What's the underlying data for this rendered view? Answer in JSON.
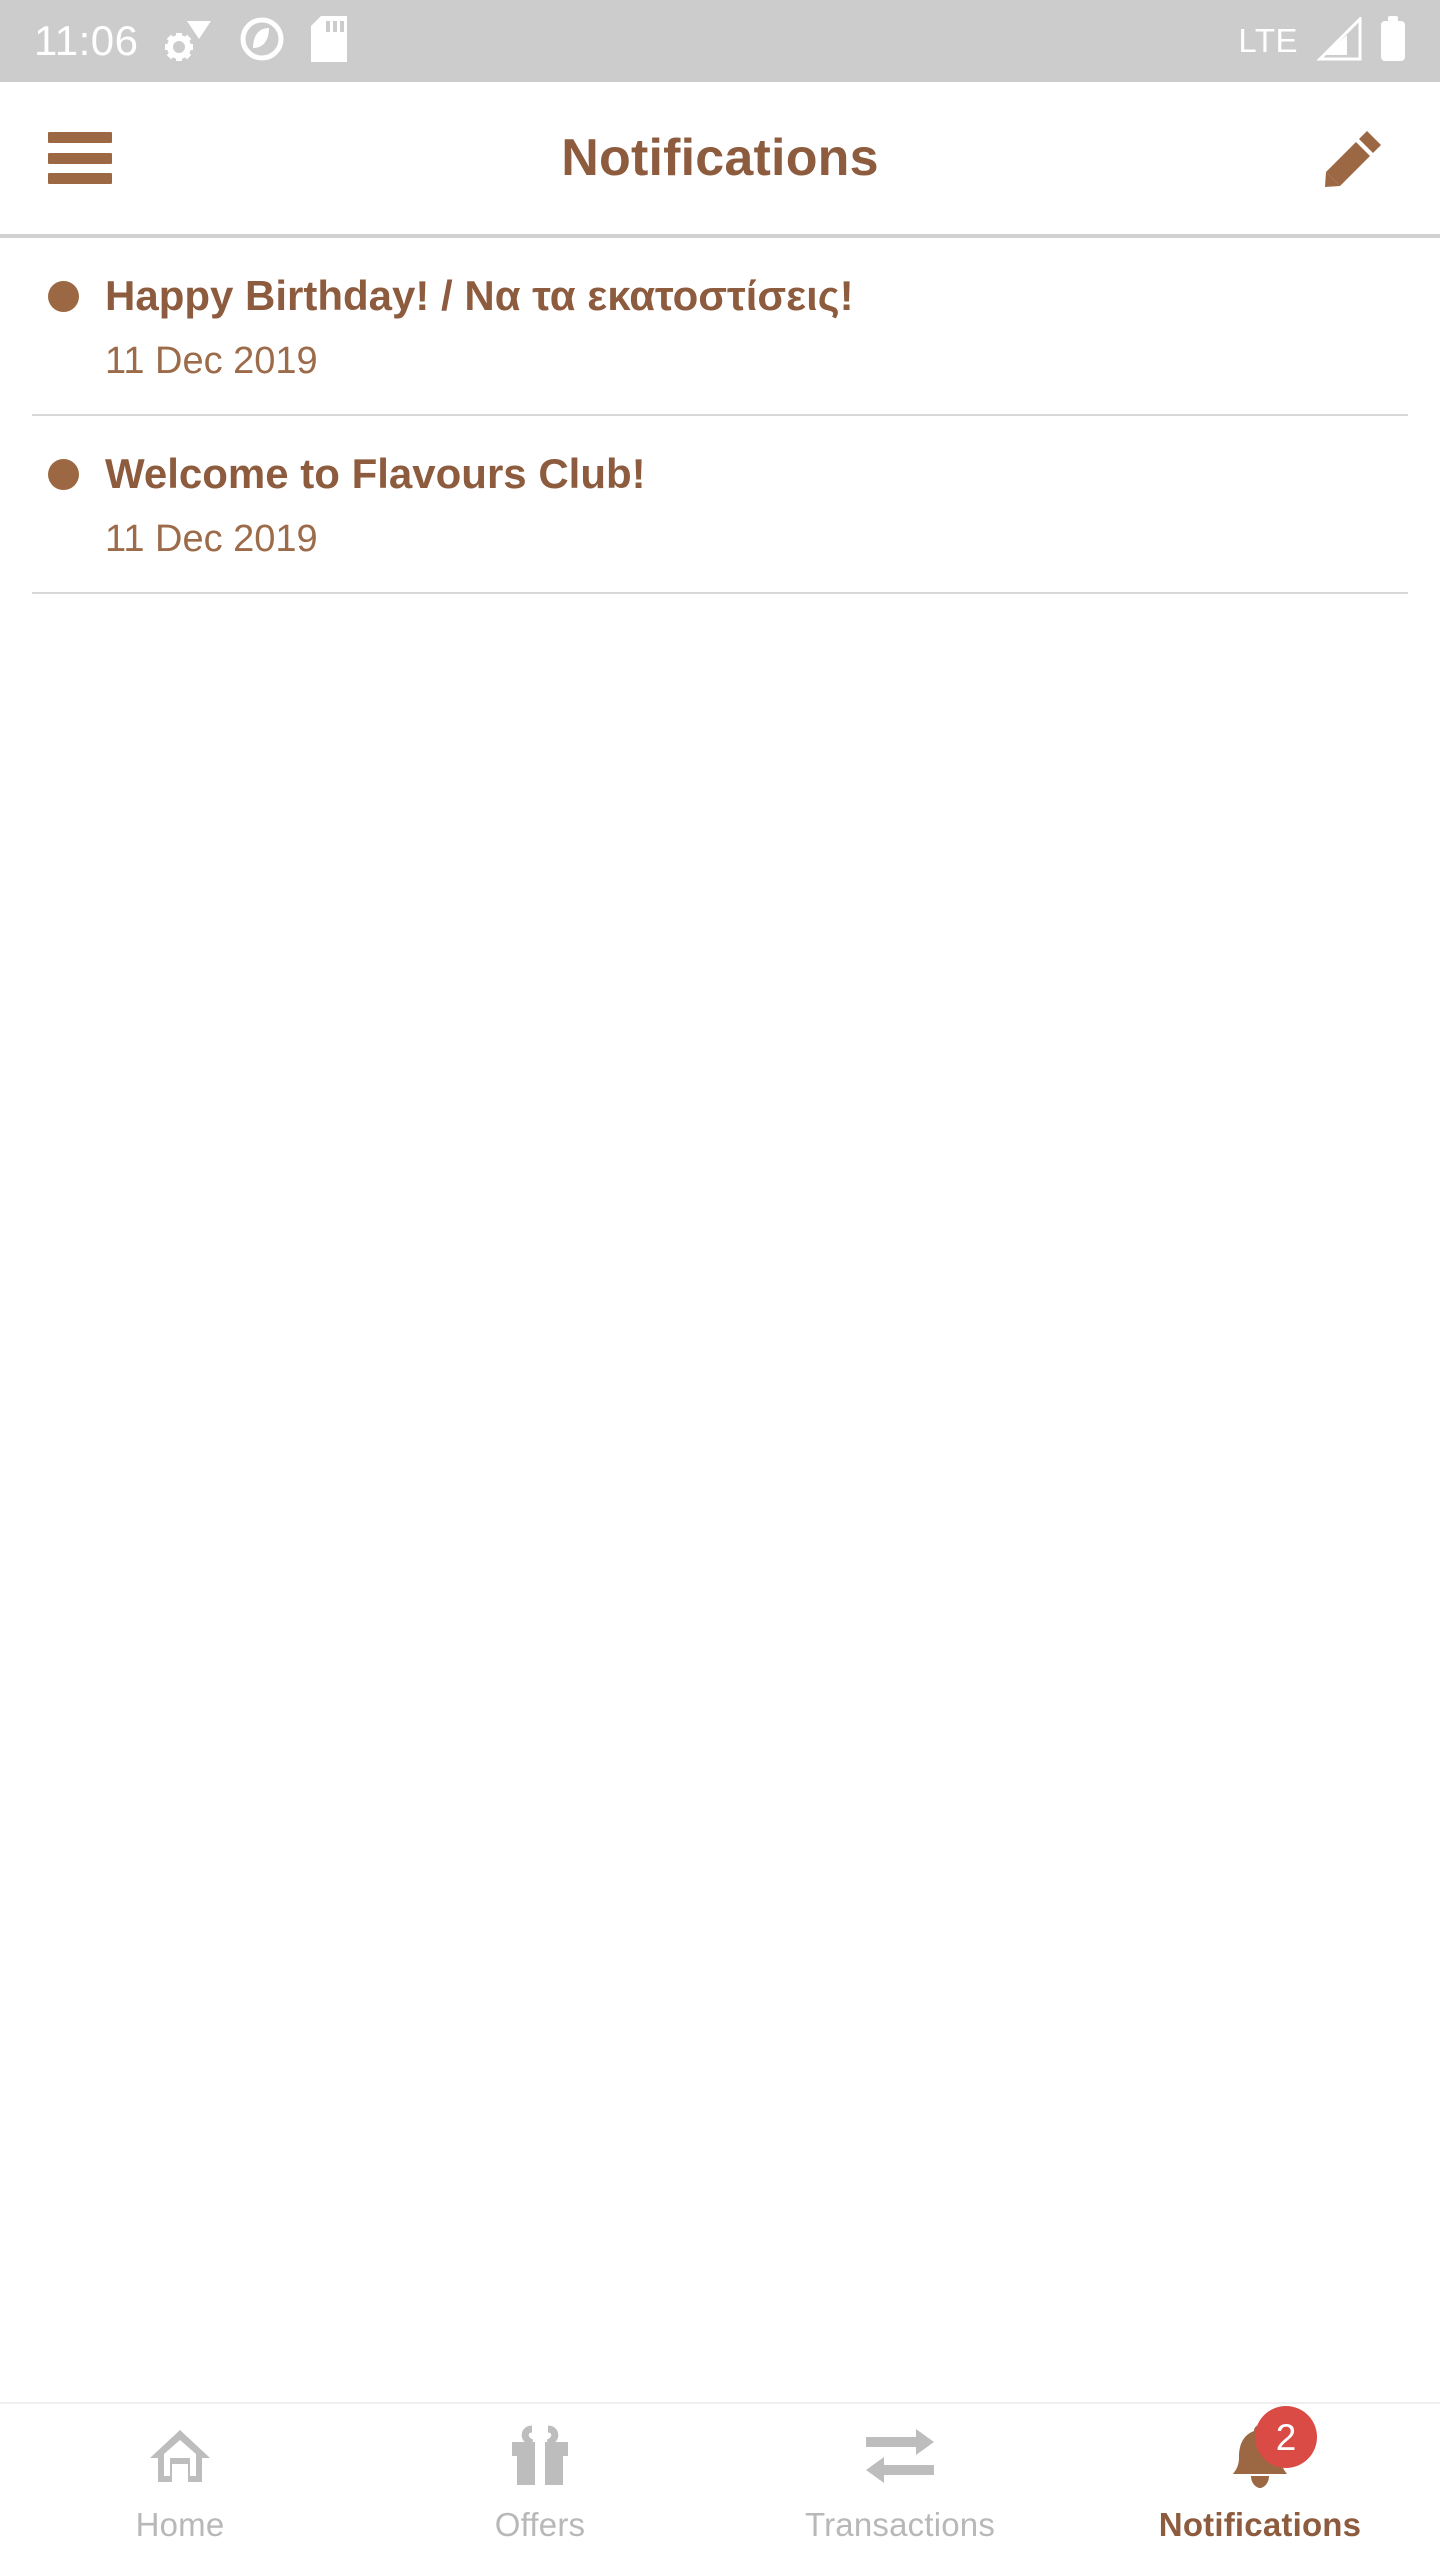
{
  "statusbar": {
    "time": "11:06",
    "icons_left": [
      "settings-wifi-icon",
      "android-q-icon",
      "sd-card-icon"
    ],
    "network_label": "LTE",
    "icons_right": [
      "signal-bars-icon",
      "battery-full-icon"
    ],
    "background": "#cccccc",
    "foreground": "#ffffff"
  },
  "header": {
    "menu_icon": "hamburger-menu-icon",
    "title": "Notifications",
    "edit_icon": "pencil-edit-icon",
    "accent": "#8D5B3E"
  },
  "notifications": [
    {
      "title": "Happy Birthday! / Να τα εκατοστίσεις!",
      "date": "11 Dec 2019",
      "unread": true
    },
    {
      "title": "Welcome to Flavours Club!",
      "date": "11 Dec 2019",
      "unread": true
    }
  ],
  "bottomnav": {
    "items": [
      {
        "label": "Home",
        "icon": "home-icon",
        "active": false,
        "badge": ""
      },
      {
        "label": "Offers",
        "icon": "gift-icon",
        "active": false,
        "badge": ""
      },
      {
        "label": "Transactions",
        "icon": "transfer-arrows-icon",
        "active": false,
        "badge": ""
      },
      {
        "label": "Notifications",
        "icon": "bell-icon",
        "active": true,
        "badge": "2"
      }
    ],
    "active_color": "#8D5B3E",
    "inactive_color": "#b8b8b8",
    "badge_color": "#D94B44"
  }
}
